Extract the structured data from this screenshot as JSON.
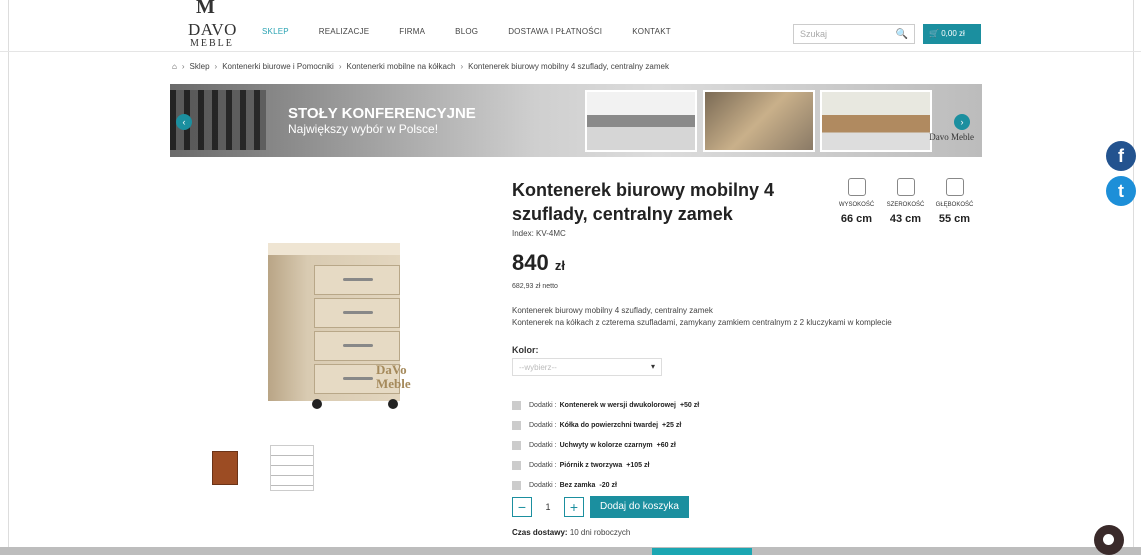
{
  "header": {
    "logo_mark": "M",
    "logo_name": "DAVO",
    "logo_sub": "MEBLE",
    "nav": [
      "SKLEP",
      "REALIZACJE",
      "FIRMA",
      "BLOG",
      "DOSTAWA I PŁATNOŚCI",
      "KONTAKT"
    ],
    "search_placeholder": "Szukaj",
    "cart_total": "0,00 zł"
  },
  "breadcrumb": [
    "Sklep",
    "Kontenerki biurowe i Pomocniki",
    "Kontenerki mobilne na kółkach",
    "Kontenerek biurowy mobilny 4 szuflady, centralny zamek"
  ],
  "banner": {
    "title": "STOŁY KONFERENCYJNE",
    "subtitle": "Największy wybór w Polsce!",
    "brand": "Davo Meble"
  },
  "product": {
    "title": "Kontenerek biurowy mobilny 4 szuflady, centralny zamek",
    "index": "Index: KV-4MC",
    "price": "840",
    "currency": "zł",
    "netto": "682,93 zł netto",
    "desc_line1": "Kontenerek biurowy mobilny 4 szuflady, centralny zamek",
    "desc_line2": "Kontenerek na kółkach z czterema szufladami, zamykany zamkiem centralnym z 2 kluczykami w komplecie",
    "color_label": "Kolor:",
    "color_placeholder": "--wybierz--",
    "watermark": "DaVo Meble",
    "dimensions": [
      {
        "label": "WYSOKOŚĆ",
        "value": "66 cm"
      },
      {
        "label": "SZEROKOŚĆ",
        "value": "43 cm"
      },
      {
        "label": "GŁĘBOKOŚĆ",
        "value": "55 cm"
      }
    ],
    "addons": [
      {
        "prefix": "Dodatki :",
        "name": "Kontenerek w wersji dwukolorowej",
        "price": "+50 zł"
      },
      {
        "prefix": "Dodatki :",
        "name": "Kółka do powierzchni twardej",
        "price": "+25 zł"
      },
      {
        "prefix": "Dodatki :",
        "name": "Uchwyty w kolorze czarnym",
        "price": "+60 zł"
      },
      {
        "prefix": "Dodatki :",
        "name": "Piórnik z tworzywa",
        "price": "+105 zł"
      },
      {
        "prefix": "Dodatki :",
        "name": "Bez zamka",
        "price": "-20 zł"
      }
    ],
    "quantity": "1",
    "minus": "−",
    "plus": "+",
    "add_to_cart": "Dodaj do koszyka",
    "delivery_label": "Czas dostawy:",
    "delivery_value": "10 dni roboczych"
  },
  "social": {
    "fb": "f",
    "tw": "t"
  },
  "colors": {
    "accent": "#1b8f9f",
    "facebook": "#23538f",
    "twitter": "#1d8fd8"
  }
}
